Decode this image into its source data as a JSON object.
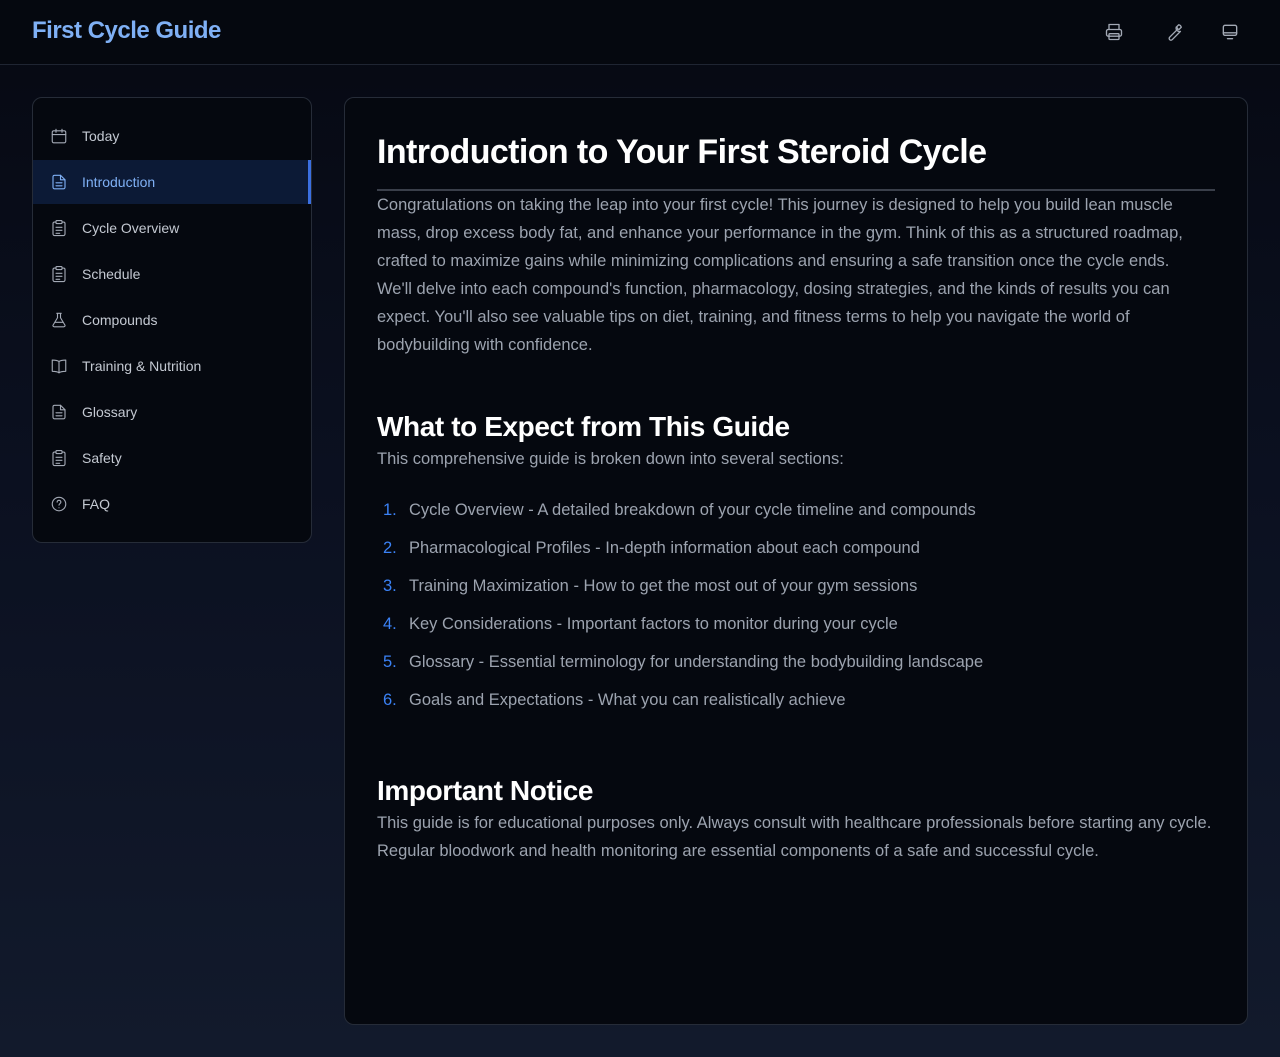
{
  "app": {
    "title": "First Cycle Guide"
  },
  "toolbar": {
    "icons": [
      "printer-icon",
      "wrench-icon",
      "monitor-icon"
    ]
  },
  "sidebar": {
    "items": [
      {
        "label": "Today",
        "icon": "calendar-icon",
        "active": false
      },
      {
        "label": "Introduction",
        "icon": "document-icon",
        "active": true
      },
      {
        "label": "Cycle Overview",
        "icon": "clipboard-icon",
        "active": false
      },
      {
        "label": "Schedule",
        "icon": "clipboard-icon",
        "active": false
      },
      {
        "label": "Compounds",
        "icon": "flask-icon",
        "active": false
      },
      {
        "label": "Training & Nutrition",
        "icon": "book-icon",
        "active": false
      },
      {
        "label": "Glossary",
        "icon": "document-icon",
        "active": false
      },
      {
        "label": "Safety",
        "icon": "clipboard-icon",
        "active": false
      },
      {
        "label": "FAQ",
        "icon": "help-circle-icon",
        "active": false
      }
    ]
  },
  "main": {
    "title": "Introduction to Your First Steroid Cycle",
    "intro": [
      "Congratulations on taking the leap into your first cycle! This journey is designed to help you build lean muscle mass, drop excess body fat, and enhance your performance in the gym. Think of this as a structured roadmap, crafted to maximize gains while minimizing complications and ensuring a safe transition once the cycle ends.",
      "We'll delve into each compound's function, pharmacology, dosing strategies, and the kinds of results you can expect. You'll also see valuable tips on diet, training, and fitness terms to help you navigate the world of bodybuilding with confidence."
    ],
    "expect": {
      "heading": "What to Expect from This Guide",
      "lead": "This comprehensive guide is broken down into several sections:",
      "items": [
        {
          "num": "1.",
          "text": "Cycle Overview - A detailed breakdown of your cycle timeline and compounds"
        },
        {
          "num": "2.",
          "text": "Pharmacological Profiles - In-depth information about each compound"
        },
        {
          "num": "3.",
          "text": "Training Maximization - How to get the most out of your gym sessions"
        },
        {
          "num": "4.",
          "text": "Key Considerations - Important factors to monitor during your cycle"
        },
        {
          "num": "5.",
          "text": "Glossary - Essential terminology for understanding the bodybuilding landscape"
        },
        {
          "num": "6.",
          "text": "Goals and Expectations - What you can realistically achieve"
        }
      ]
    },
    "notice": {
      "heading": "Important Notice",
      "body": "This guide is for educational purposes only. Always consult with healthcare professionals before starting any cycle. Regular bloodwork and health monitoring are essential components of a safe and successful cycle."
    }
  },
  "colors": {
    "accent": "#7fb0f5",
    "active_bar": "#3b6fe0",
    "list_number": "#3b82f6"
  }
}
